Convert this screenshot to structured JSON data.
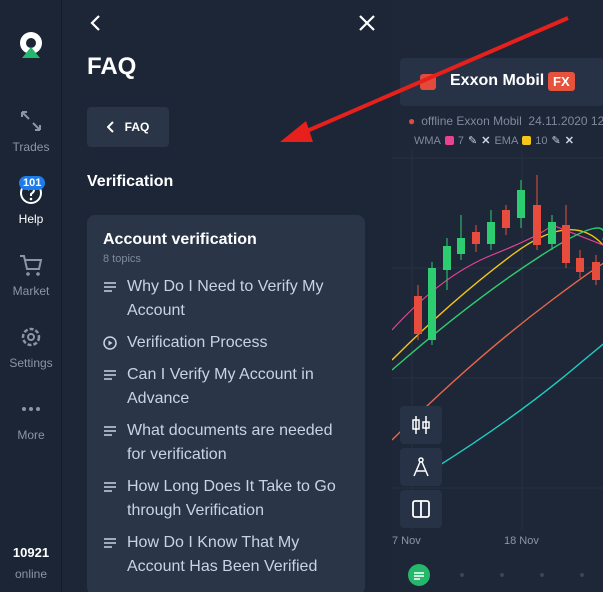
{
  "sidebar": {
    "items": [
      {
        "label": "Trades"
      },
      {
        "label": "Help",
        "badge": "101"
      },
      {
        "label": "Market"
      },
      {
        "label": "Settings"
      },
      {
        "label": "More"
      }
    ],
    "online_count": "10921",
    "online_label": "online"
  },
  "faq": {
    "title": "FAQ",
    "breadcrumb": "FAQ",
    "section": "Verification",
    "card": {
      "title": "Account verification",
      "subtitle": "8 topics",
      "topics": [
        {
          "label": "Why Do I Need to Verify My Account",
          "icon": "list-icon"
        },
        {
          "label": "Verification Process",
          "icon": "play-circle-icon"
        },
        {
          "label": "Can I Verify My Account in Advance",
          "icon": "list-icon"
        },
        {
          "label": "What documents are needed for verification",
          "icon": "list-icon"
        },
        {
          "label": "How Long Does It Take to Go through Verification",
          "icon": "list-icon"
        },
        {
          "label": "How Do I Know That My Account Has Been Verified",
          "icon": "list-icon"
        }
      ]
    }
  },
  "chart": {
    "asset_name": "Exxon Mobil",
    "asset_badge": "FX",
    "status": "offline Exxon Mobil",
    "date": "24.11.2020 12",
    "indicators": [
      {
        "name": "WMA",
        "value": "7",
        "color": "#e84393"
      },
      {
        "name": "EMA",
        "value": "10",
        "color": "#f5c518"
      }
    ],
    "dates": [
      "7 Nov",
      "18 Nov"
    ]
  },
  "colors": {
    "accent": "#1e7ce8",
    "annotation_arrow": "#e8201c",
    "up_candle": "#2ecc71",
    "down_candle": "#e74c3c"
  }
}
